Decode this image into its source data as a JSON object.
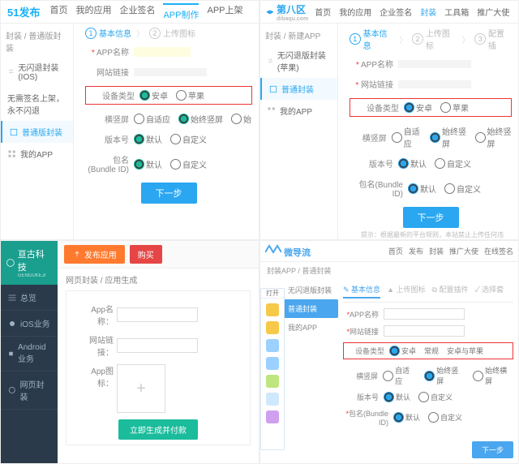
{
  "q1": {
    "logo": "51发布",
    "nav": [
      "首页",
      "我的应用",
      "企业签名",
      "APP制作",
      "APP上架"
    ],
    "bc": "封装 / 普通版封装",
    "side": {
      "ios": "无闪退封装 (IOS)",
      "ios_tip": "无需签名上架，永不闪退",
      "normal": "普通版封装",
      "myapp": "我的APP"
    },
    "steps": {
      "s1": "基本信息",
      "s2": "上传图标"
    },
    "labels": {
      "app_name": "APP名称",
      "web_url": "网站链接",
      "dev_type": "设备类型",
      "orient": "横竖屏",
      "version": "版本号",
      "bundle": "包名(Bundle ID)"
    },
    "opts": {
      "android": "安卓",
      "apple": "苹果",
      "auto": "自适应",
      "portrait": "始终竖屏",
      "begin": "始",
      "default": "默认",
      "custom": "自定义"
    },
    "next": "下一步"
  },
  "q2": {
    "logo": "第八区",
    "logo_sub": "dibaqu.com",
    "nav": [
      "首页",
      "我的应用",
      "企业签名",
      "封装",
      "工具箱",
      "推广大使"
    ],
    "bc": "封装 / 新建APP",
    "side": {
      "ios": "无闪退版封装 (苹果)",
      "normal": "普通封装",
      "myapp": "我的APP"
    },
    "steps": {
      "s1": "基本信息",
      "s2": "上传图标",
      "s3": "配置插"
    },
    "labels": {
      "app_name": "APP名称",
      "web_url": "网站链接",
      "dev_type": "设备类型",
      "orient": "横竖屏",
      "version": "版本号",
      "bundle": "包名(Bundle ID)"
    },
    "opts": {
      "android": "安卓",
      "apple": "苹果",
      "auto": "自适应",
      "portrait": "始终竖屏",
      "landscape": "始终竖屏",
      "default": "默认",
      "custom": "自定义"
    },
    "next": "下一步",
    "foot": "提示：根据最新的平台规则，本站禁止上传任何违反国家法律的相关内容，若您违反立即做封。"
  },
  "q3": {
    "logo": "亘古科技",
    "logo_sub": "GENGUKEJI",
    "side": [
      "总览",
      "iOS业务",
      "Android业务",
      "网页封装"
    ],
    "publish": "发布应用",
    "buy": "购买",
    "bc": "网页封装 / 应用生成",
    "labels": {
      "name": "App名称：",
      "url": "网站链接：",
      "icon": "App图标："
    },
    "submit": "立即生成并付款",
    "popup": "打开"
  },
  "q4": {
    "logo": "微导流",
    "nav": [
      "首页",
      "发布",
      "封装",
      "推广大使",
      "在线签名"
    ],
    "bc": "封装APP / 普通封装",
    "side": {
      "ios": "无闪退版封装",
      "normal": "普通封装",
      "myapp": "我的APP"
    },
    "steps": {
      "s1": "基本信息",
      "s2": "上传图标",
      "s3": "配置插件",
      "s4": "选择套"
    },
    "labels": {
      "name": "APP名称",
      "url": "网站链接",
      "dev": "设备类型",
      "orient": "横竖屏",
      "ver": "版本号",
      "bundle": "包名(Bundle ID)"
    },
    "opts": {
      "android": "安卓",
      "normal": "常规",
      "both": "安卓与苹果",
      "auto": "自适应",
      "portrait": "始终竖屏",
      "landscape": "始终横屏",
      "default": "默认",
      "custom": "自定义"
    },
    "next": "下一步"
  }
}
